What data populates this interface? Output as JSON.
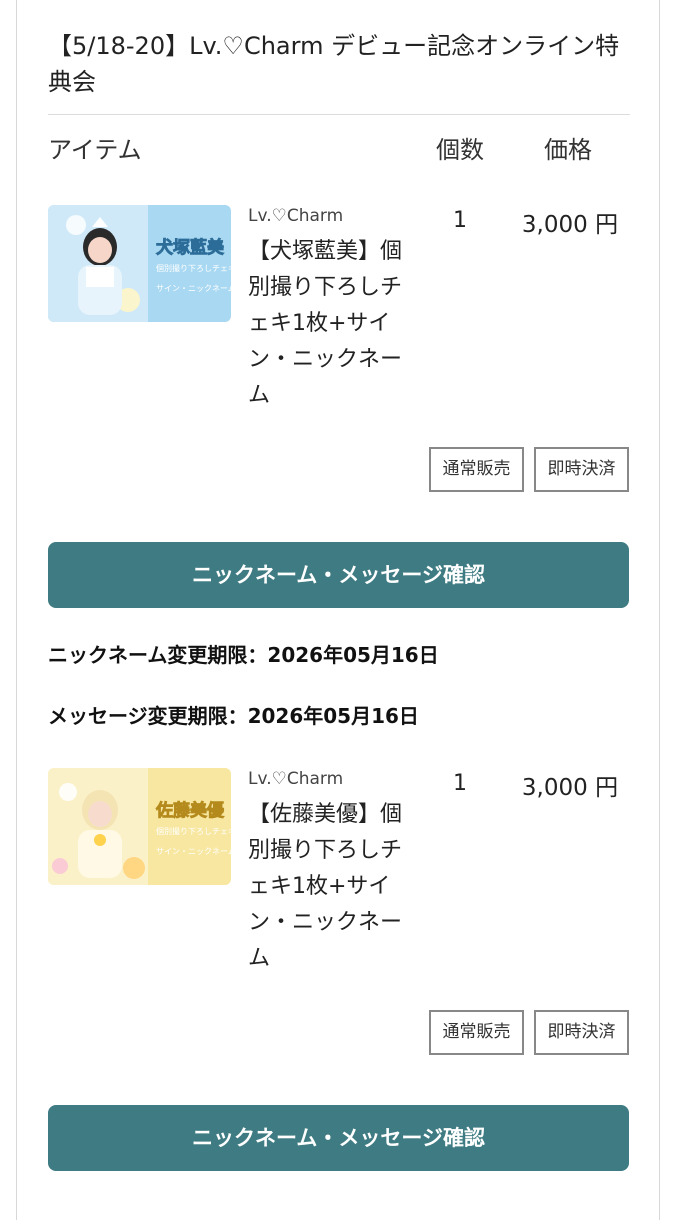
{
  "event": {
    "title": "【5/18-20】Lv.♡Charm デビュー記念オンライン特典会"
  },
  "headers": {
    "item": "アイテム",
    "quantity": "個数",
    "price": "価格"
  },
  "items": [
    {
      "brand": "Lv.♡Charm",
      "name": "【犬塚藍美】個別撮り下ろしチェキ1枚+サイン・ニックネーム",
      "quantity": "1",
      "price": "3,000 円",
      "thumb_label": "犬塚藍美",
      "thumb_sub": "個別撮り下ろしチェキ",
      "thumb_sub2": "サイン・ニックネーム",
      "thumb_color": "#a9d8f2",
      "normal_sale": "通常販売",
      "instant_pay": "即時決済",
      "confirm": "ニックネーム・メッセージ確認",
      "nickname_deadline": "ニックネーム変更期限：2026年05月16日",
      "message_deadline": "メッセージ変更期限：2026年05月16日"
    },
    {
      "brand": "Lv.♡Charm",
      "name": "【佐藤美優】個別撮り下ろしチェキ1枚+サイン・ニックネーム",
      "quantity": "1",
      "price": "3,000 円",
      "thumb_label": "佐藤美優",
      "thumb_sub": "個別撮り下ろしチェキ",
      "thumb_sub2": "サイン・ニックネーム",
      "thumb_color": "#f7e7a0",
      "normal_sale": "通常販売",
      "instant_pay": "即時決済",
      "confirm": "ニックネーム・メッセージ確認"
    }
  ],
  "colors": {
    "button": "#3e7b82",
    "button_text": "#ffffff"
  }
}
